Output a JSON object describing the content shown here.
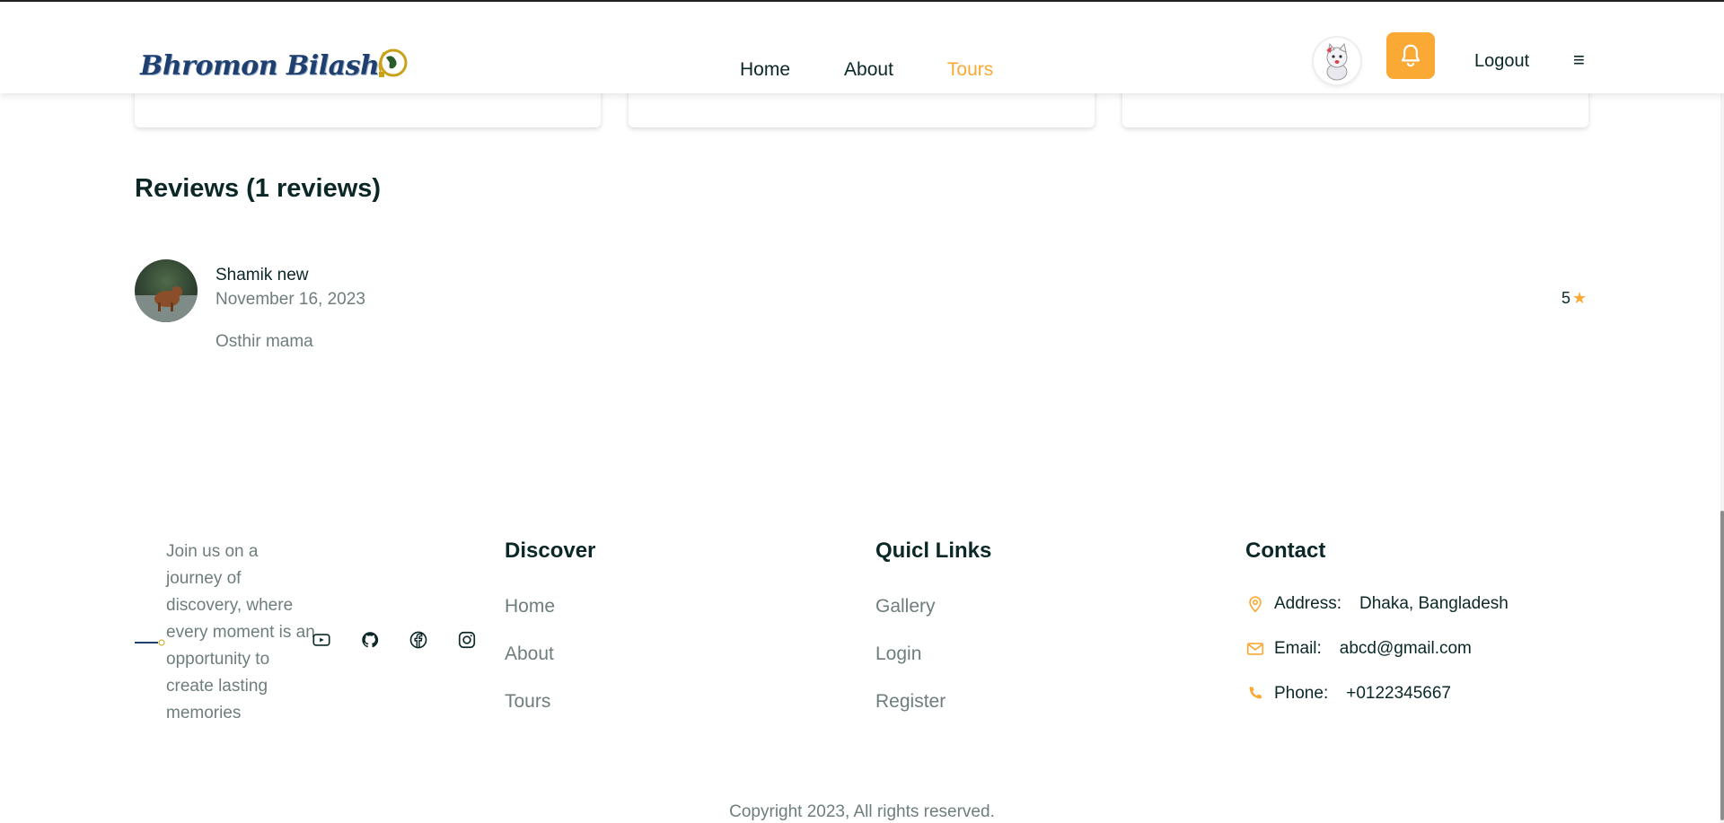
{
  "header": {
    "logo_text": "Bhromon Bilash",
    "nav": [
      {
        "label": "Home",
        "active": false
      },
      {
        "label": "About",
        "active": false
      },
      {
        "label": "Tours",
        "active": true
      }
    ],
    "logout_label": "Logout",
    "menu_glyph": "≡",
    "icons": {
      "bell": "bell-icon",
      "avatar": "cat-avatar",
      "menu": "hamburger-menu-icon"
    }
  },
  "reviews": {
    "title": "Reviews (1 reviews)",
    "items": [
      {
        "name": "Shamik new",
        "date": "November 16, 2023",
        "text": "Osthir mama",
        "rating": "5",
        "rating_icon": "star-icon"
      }
    ]
  },
  "footer": {
    "tagline": "Join us on a journey of discovery, where every moment is an opportunity to create lasting memories",
    "social_icons": [
      "youtube-icon",
      "github-icon",
      "facebook-icon",
      "instagram-icon"
    ],
    "discover": {
      "title": "Discover",
      "links": [
        "Home",
        "About",
        "Tours"
      ]
    },
    "quick_links": {
      "title": "Quicl Links",
      "links": [
        "Gallery",
        "Login",
        "Register"
      ]
    },
    "contact": {
      "title": "Contact",
      "rows": [
        {
          "label": "Address:",
          "value": "Dhaka, Bangladesh",
          "icon": "location-pin-icon"
        },
        {
          "label": "Email:",
          "value": "abcd@gmail.com",
          "icon": "mail-icon"
        },
        {
          "label": "Phone:",
          "value": "+0122345667",
          "icon": "phone-icon"
        }
      ]
    },
    "copyright": "Copyright 2023, All rights reserved."
  },
  "colors": {
    "accent": "#faa935",
    "heading": "#0b2727",
    "muted": "#6e7d7d"
  }
}
